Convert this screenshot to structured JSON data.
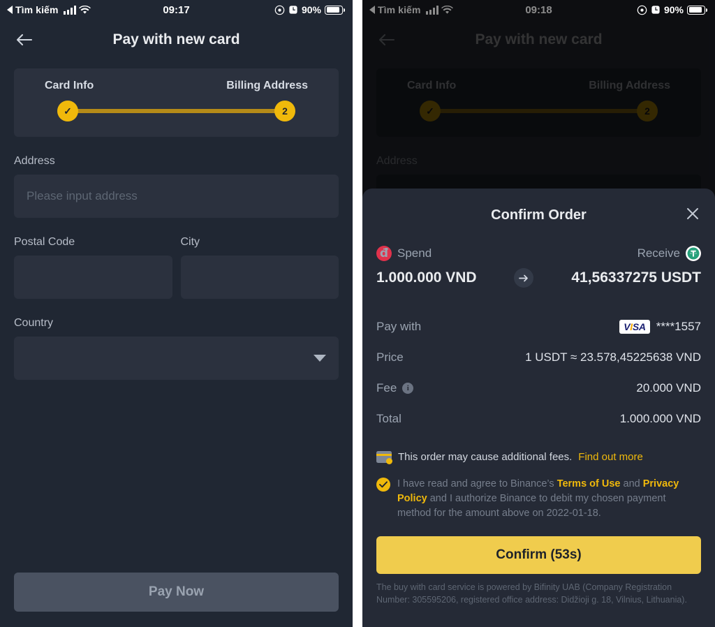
{
  "left": {
    "status": {
      "carrier": "Tìm kiếm",
      "time": "09:17",
      "battery": "90%"
    },
    "nav": {
      "title": "Pay with new card"
    },
    "stepper": {
      "step1_label": "Card Info",
      "step2_label": "Billing Address",
      "step1_mark": "✓",
      "step2_mark": "2"
    },
    "form": {
      "address_label": "Address",
      "address_placeholder": "Please input address",
      "address_value": "",
      "postal_label": "Postal Code",
      "postal_value": "",
      "city_label": "City",
      "city_value": "",
      "country_label": "Country",
      "country_value": ""
    },
    "pay_now_label": "Pay Now"
  },
  "right": {
    "status": {
      "carrier": "Tìm kiếm",
      "time": "09:18",
      "battery": "90%"
    },
    "nav": {
      "title": "Pay with new card"
    },
    "stepper": {
      "step1_label": "Card Info",
      "step2_label": "Billing Address",
      "step1_mark": "✓",
      "step2_mark": "2"
    },
    "form": {
      "address_label": "Address"
    },
    "modal": {
      "title": "Confirm Order",
      "close_label": "✕",
      "spend_label": "Spend",
      "spend_coin": "đ",
      "spend_value": "1.000.000 VND",
      "receive_label": "Receive",
      "receive_value": "41,56337275 USDT",
      "rows": [
        {
          "label": "Pay with",
          "value": "****1557",
          "has_visa": true,
          "visa_text": "VISA"
        },
        {
          "label": "Price",
          "value": "1 USDT ≈ 23.578,45225638 VND"
        },
        {
          "label": "Fee",
          "value": "20.000 VND",
          "has_info": true
        },
        {
          "label": "Total",
          "value": "1.000.000 VND"
        }
      ],
      "notice_text": "This order may cause additional fees.",
      "notice_link": "Find out more",
      "consent": {
        "part1": "I have read and agree to Binance’s ",
        "terms": "Terms of Use",
        "part2": " and ",
        "privacy": "Privacy Policy",
        "part3": " and I authorize Binance to debit my chosen payment method for the amount above on 2022-01-18."
      },
      "confirm_label": "Confirm (53s)",
      "fineprint": "The buy with card service is powered by Bifinity UAB (Company Registration Number: 305595206, registered office address: Didžioji g. 18, Vilnius, Lithuania)."
    }
  },
  "colors": {
    "accent": "#f0b90b",
    "confirm": "#f0cc4d",
    "panel": "#2b313e",
    "modal_bg": "#252a36"
  }
}
